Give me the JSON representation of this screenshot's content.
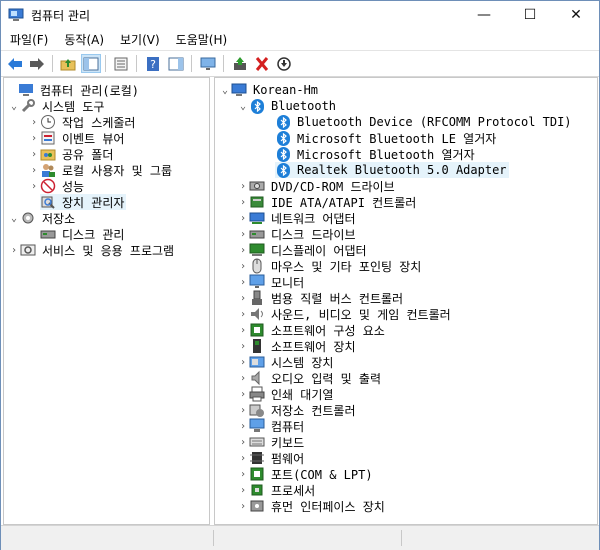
{
  "window": {
    "title": "컴퓨터 관리",
    "controls": {
      "minimize": "—",
      "maximize": "☐",
      "close": "✕"
    }
  },
  "menu": [
    "파일(F)",
    "동작(A)",
    "보기(V)",
    "도움말(H)"
  ],
  "toolbar": {
    "buttons": [
      "back-icon",
      "forward-icon",
      "up-folder-icon",
      "show-hide-tree-icon",
      "properties-icon",
      "help-icon",
      "action-pane-icon",
      "monitor-icon",
      "update-driver-icon",
      "uninstall-icon",
      "download-icon"
    ]
  },
  "left_tree": {
    "items": [
      {
        "label": "컴퓨터 관리(로컬)",
        "icon": "computer-management-icon"
      },
      {
        "label": "시스템 도구",
        "icon": "tools-icon"
      },
      {
        "label": "작업 스케줄러",
        "icon": "clock-icon"
      },
      {
        "label": "이벤트 뷰어",
        "icon": "event-viewer-icon"
      },
      {
        "label": "공유 폴더",
        "icon": "shared-folder-icon"
      },
      {
        "label": "로컬 사용자 및 그룹",
        "icon": "users-icon"
      },
      {
        "label": "성능",
        "icon": "performance-icon"
      },
      {
        "label": "장치 관리자",
        "icon": "device-manager-icon"
      },
      {
        "label": "저장소",
        "icon": "storage-icon"
      },
      {
        "label": "디스크 관리",
        "icon": "disk-icon"
      },
      {
        "label": "서비스 및 응용 프로그램",
        "icon": "services-icon"
      }
    ]
  },
  "right_tree": {
    "root": "Korean-Hm",
    "bluetooth": {
      "label": "Bluetooth",
      "children": [
        "Bluetooth Device (RFCOMM Protocol TDI)",
        "Microsoft Bluetooth LE 열거자",
        "Microsoft Bluetooth 열거자",
        "Realtek Bluetooth 5.0 Adapter"
      ]
    },
    "categories": [
      {
        "label": "DVD/CD-ROM 드라이브",
        "icon": "dvd-drive-icon"
      },
      {
        "label": "IDE ATA/ATAPI 컨트롤러",
        "icon": "ide-controller-icon"
      },
      {
        "label": "네트워크 어댑터",
        "icon": "network-adapter-icon"
      },
      {
        "label": "디스크 드라이브",
        "icon": "disk-drive-icon"
      },
      {
        "label": "디스플레이 어댑터",
        "icon": "display-adapter-icon"
      },
      {
        "label": "마우스 및 기타 포인팅 장치",
        "icon": "mouse-icon"
      },
      {
        "label": "모니터",
        "icon": "monitor-icon"
      },
      {
        "label": "범용 직렬 버스 컨트롤러",
        "icon": "usb-icon"
      },
      {
        "label": "사운드, 비디오 및 게임 컨트롤러",
        "icon": "sound-icon"
      },
      {
        "label": "소프트웨어 구성 요소",
        "icon": "software-component-icon"
      },
      {
        "label": "소프트웨어 장치",
        "icon": "software-device-icon"
      },
      {
        "label": "시스템 장치",
        "icon": "system-device-icon"
      },
      {
        "label": "오디오 입력 및 출력",
        "icon": "audio-icon"
      },
      {
        "label": "인쇄 대기열",
        "icon": "printer-icon"
      },
      {
        "label": "저장소 컨트롤러",
        "icon": "storage-controller-icon"
      },
      {
        "label": "컴퓨터",
        "icon": "computer-icon"
      },
      {
        "label": "키보드",
        "icon": "keyboard-icon"
      },
      {
        "label": "펌웨어",
        "icon": "firmware-icon"
      },
      {
        "label": "포트(COM & LPT)",
        "icon": "port-icon"
      },
      {
        "label": "프로세서",
        "icon": "processor-icon"
      },
      {
        "label": "휴먼 인터페이스 장치",
        "icon": "hid-icon"
      }
    ]
  },
  "colors": {
    "accent": "#1e7fd8",
    "selection": "#e5f3fb",
    "border": "#6e8fb8"
  }
}
